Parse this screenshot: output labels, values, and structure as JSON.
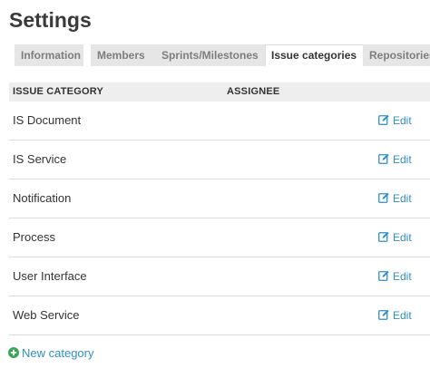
{
  "page": {
    "title": "Settings"
  },
  "tabs": [
    {
      "label": "Information"
    },
    {
      "label": "Members"
    },
    {
      "label": "Sprints/Milestones"
    },
    {
      "label": "Issue categories",
      "active": true
    },
    {
      "label": "Repositories"
    }
  ],
  "table": {
    "headers": {
      "category": "ISSUE CATEGORY",
      "assignee": "ASSIGNEE"
    },
    "rows": [
      {
        "category": "IS Document",
        "assignee": "",
        "action": "Edit"
      },
      {
        "category": "IS Service",
        "assignee": "",
        "action": "Edit"
      },
      {
        "category": "Notification",
        "assignee": "",
        "action": "Edit"
      },
      {
        "category": "Process",
        "assignee": "",
        "action": "Edit"
      },
      {
        "category": "User Interface",
        "assignee": "",
        "action": "Edit"
      },
      {
        "category": "Web Service",
        "assignee": "",
        "action": "Edit"
      }
    ]
  },
  "actions": {
    "new_category": "New category"
  },
  "colors": {
    "link": "#2f8fc6",
    "add_icon": "#3aa655",
    "tab_inactive_bg": "#e6e6e6",
    "header_bg": "#eeeeee"
  },
  "icons": {
    "edit": "edit-icon",
    "add": "plus-circle-icon"
  }
}
